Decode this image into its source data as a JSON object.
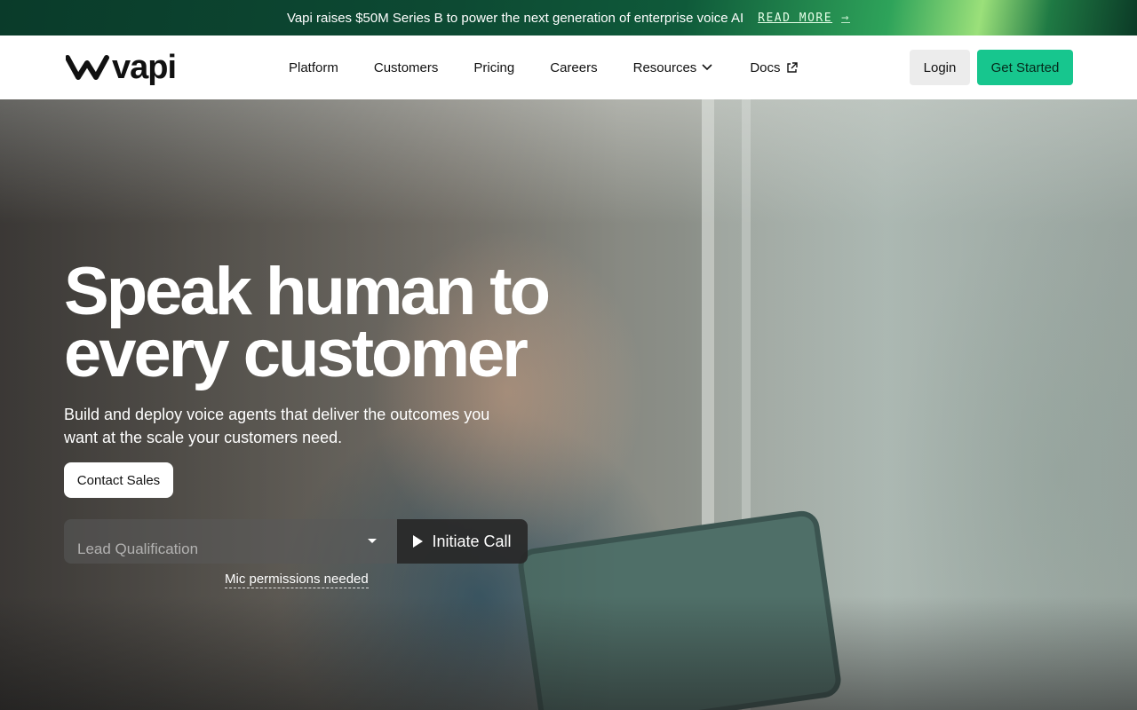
{
  "announcement": {
    "text": "Vapi raises $50M Series B to power the next generation of enterprise voice AI",
    "link_label": "READ MORE",
    "arrow": "→"
  },
  "nav": {
    "logo_text": "vapi",
    "links": [
      "Platform",
      "Customers",
      "Pricing",
      "Careers",
      "Resources",
      "Docs"
    ],
    "login_label": "Login",
    "cta_label": "Get Started",
    "cta_color": "#17c68e"
  },
  "hero": {
    "headline_line1": "Speak human to",
    "headline_line2": "every customer",
    "subhead": "Build and deploy voice agents that deliver the outcomes you want at the scale your customers need.",
    "contact_label": "Contact Sales",
    "select_value": "Lead Qualification",
    "call_label": "Initiate Call",
    "mic_note": "Mic permissions needed"
  },
  "icons": {
    "logo_mark": "wave-logo-icon",
    "resources_caret": "chevron-down-icon",
    "docs_external": "external-link-icon",
    "select_caret": "caret-down-icon",
    "call_play": "play-icon"
  }
}
